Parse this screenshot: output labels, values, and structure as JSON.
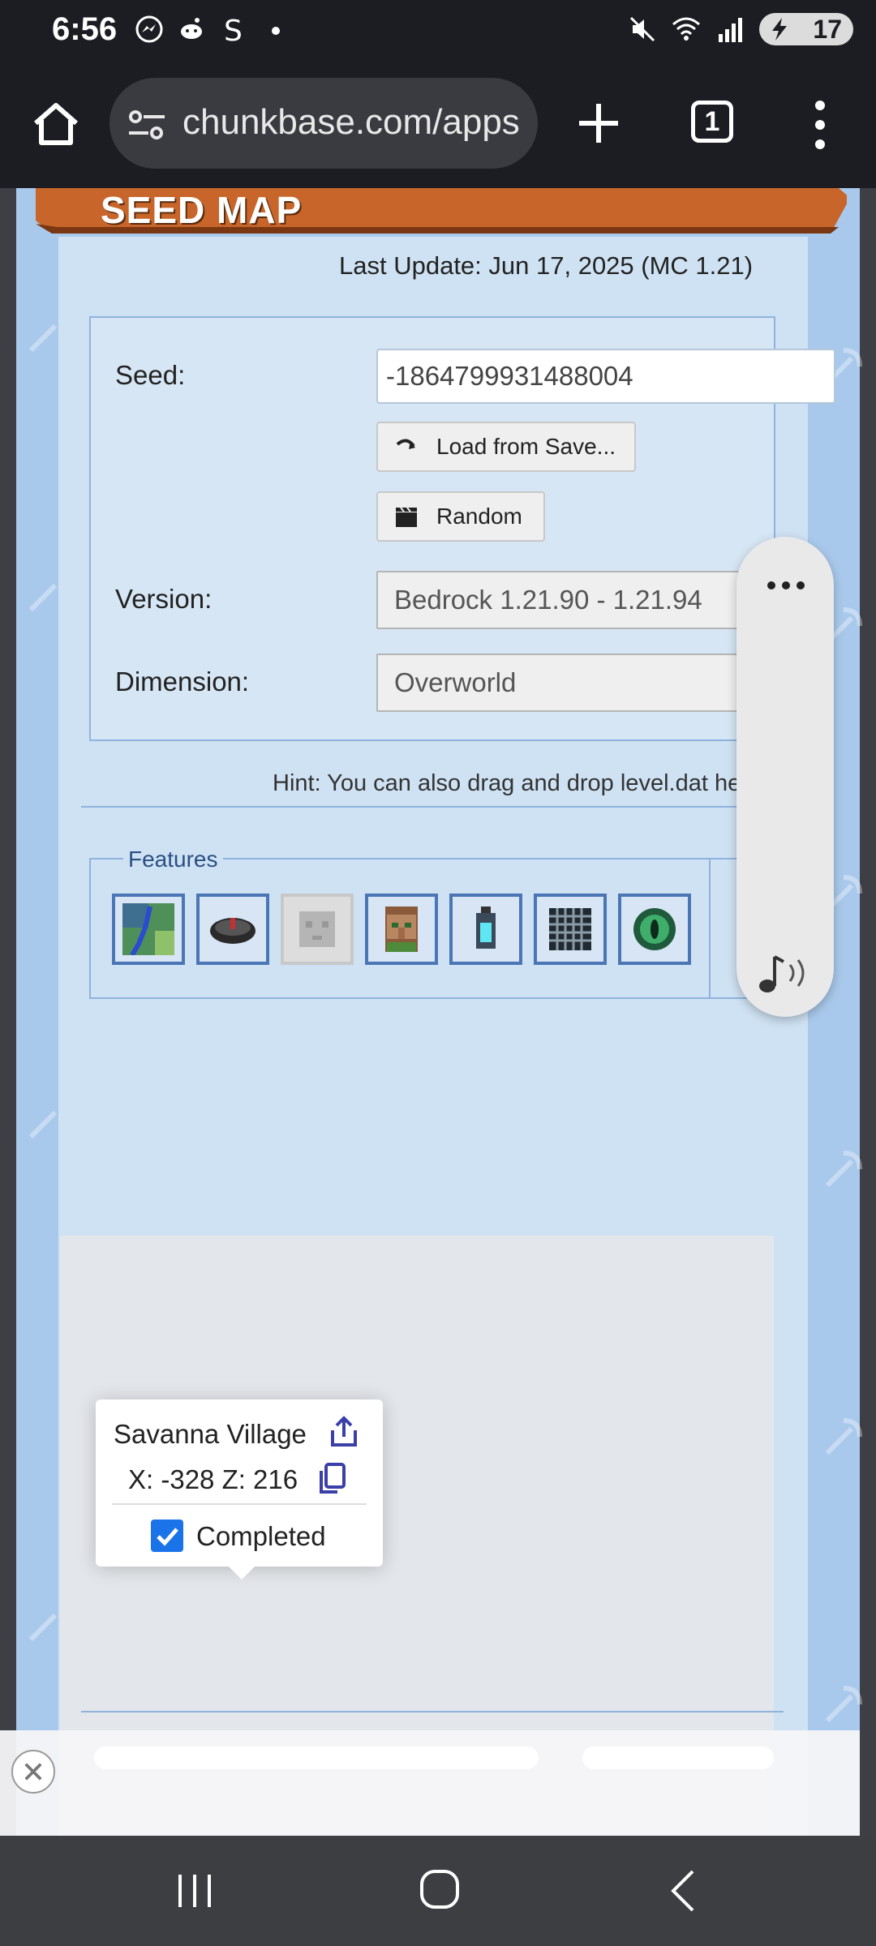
{
  "status_bar": {
    "time": "6:56",
    "battery": "17"
  },
  "browser": {
    "url": "chunkbase.com/apps",
    "tab_count": "1"
  },
  "page": {
    "banner_title": "SEED MAP",
    "last_update": "Last Update: Jun 17, 2025 (MC 1.21)",
    "seed_label": "Seed:",
    "seed_value": "-1864799931488004",
    "load_button": "Load from Save...",
    "random_button": "Random",
    "version_label": "Version:",
    "version_value": "Bedrock 1.21.90 - 1.21.94",
    "dimension_label": "Dimension:",
    "dimension_value": "Overworld",
    "hint": "Hint: You can also drag and drop level.dat he",
    "features_legend": "Features"
  },
  "features": [
    {
      "name": "biome-map-icon",
      "enabled": true
    },
    {
      "name": "pressure-plate-icon",
      "enabled": true
    },
    {
      "name": "slime-icon",
      "enabled": false
    },
    {
      "name": "villager-icon",
      "enabled": true
    },
    {
      "name": "lantern-icon",
      "enabled": true
    },
    {
      "name": "spawner-cage-icon",
      "enabled": true
    },
    {
      "name": "ender-eye-icon",
      "enabled": true
    }
  ],
  "popup": {
    "title": "Savanna Village",
    "coords": "X: -328 Z: 216",
    "checkbox_label": "Completed",
    "checked": true
  },
  "colors": {
    "accent": "#1a73e8",
    "feature_border": "#4b76b5",
    "page_bg": "#cfe2f3"
  }
}
